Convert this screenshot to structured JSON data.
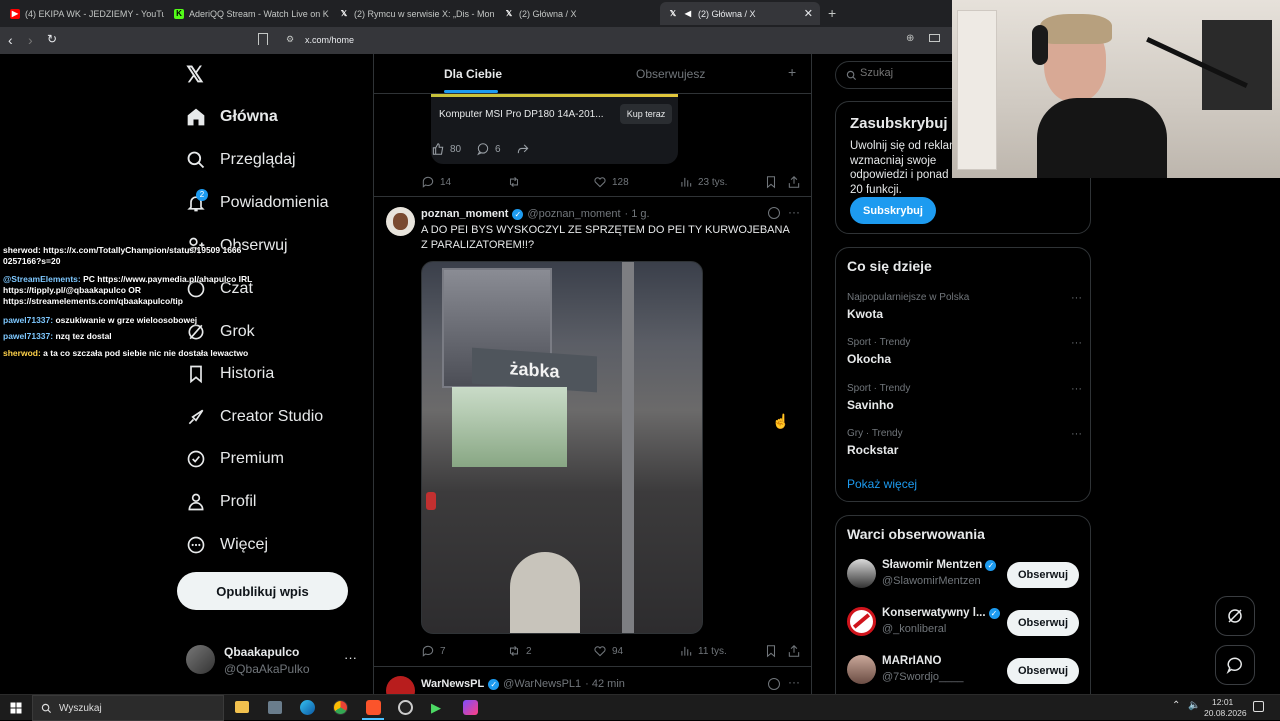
{
  "browser": {
    "tabs": [
      {
        "label": "(4) EKIPA WK - JEDZIEMY - YouTube",
        "color": "#ff0000"
      },
      {
        "label": "AderiQQ Stream - Watch Live on Kick",
        "color": "#53fc18"
      },
      {
        "label": "(2) Rymcu w serwisie X: „Dis - Monst",
        "color": "#ffffff"
      },
      {
        "label": "(2) Główna / X",
        "color": "#ffffff"
      },
      {
        "label": "(2) Główna / X",
        "color": "#ffffff"
      }
    ],
    "url": "x.com/home"
  },
  "sidebar": {
    "items": [
      {
        "label": "Główna",
        "icon": "home-icon"
      },
      {
        "label": "Przeglądaj",
        "icon": "search-icon"
      },
      {
        "label": "Powiadomienia",
        "icon": "bell-icon",
        "badge": "2"
      },
      {
        "label": "Obserwuj",
        "icon": "person-add-icon"
      },
      {
        "label": "Czat",
        "icon": "chat-icon"
      },
      {
        "label": "Grok",
        "icon": "grok-icon"
      },
      {
        "label": "Historia",
        "icon": "bookmark-icon"
      },
      {
        "label": "Creator Studio",
        "icon": "rocket-icon"
      },
      {
        "label": "Premium",
        "icon": "verified-icon"
      },
      {
        "label": "Profil",
        "icon": "profile-icon"
      },
      {
        "label": "Więcej",
        "icon": "more-icon"
      }
    ],
    "post_button": "Opublikuj wpis",
    "account": {
      "name": "Qbaakapulco",
      "handle": "@QbaAkaPulko"
    }
  },
  "feed": {
    "tabs": [
      "Dla Ciebie",
      "Obserwujesz"
    ],
    "ad": {
      "product": "Komputer MSI Pro DP180 14A-201...",
      "button": "Kup teraz",
      "likes": "80",
      "replies": "6"
    },
    "post0_stats": {
      "replies": "14",
      "likes": "128",
      "views": "23 tys."
    },
    "post1": {
      "name": "poznan_moment",
      "handle": "@poznan_moment",
      "time": "· 1 g.",
      "text": "A DO PEI BYS WYSKOCZYL ZE SPRZĘTEM DO PEI TY KURWOJEBANA Z PARALIZATOREM!!?",
      "stats": {
        "replies": "7",
        "reposts": "2",
        "likes": "94",
        "views": "11 tys."
      }
    },
    "post2": {
      "name": "WarNewsPL",
      "handle": "@WarNewsPL1",
      "time": "· 42 min"
    }
  },
  "right": {
    "search_placeholder": "Szukaj",
    "subscribe": {
      "title": "Zasubskrybuj",
      "text": "Uwolnij się od reklam, wzmacniaj swoje odpowiedzi i ponad 20 funkcji.",
      "button": "Subskrybuj"
    },
    "trends": {
      "title": "Co się dzieje",
      "items": [
        {
          "meta": "Najpopularniejsze w Polska",
          "name": "Kwota"
        },
        {
          "meta": "Sport · Trendy",
          "name": "Okocha"
        },
        {
          "meta": "Sport · Trendy",
          "name": "Savinho"
        },
        {
          "meta": "Gry · Trendy",
          "name": "Rockstar"
        }
      ],
      "show_more": "Pokaż więcej"
    },
    "who_to_follow": {
      "title": "Warci obserwowania",
      "users": [
        {
          "name": "Sławomir Mentzen",
          "handle": "@SlawomirMentzen"
        },
        {
          "name": "Konserwatywny l...",
          "handle": "@_konliberal"
        },
        {
          "name": "MARrIANO",
          "handle": "@7Swordjo____"
        }
      ],
      "follow_label": "Obserwuj"
    }
  },
  "chat": {
    "lines": [
      {
        "user": "sherwod:",
        "text": "https://x.com/TotallyChampion/status/19509 1666 0257166?s=20",
        "user_color": "#ffffff"
      },
      {
        "user": "@StreamElements:",
        "text": "PC https://www.paymedia.pl/ahapulco IRL https://tipply.pl/@qbaakapulco OR https://streamelements.com/qbaakapulco/tip",
        "user_color": "#7ec8ff"
      },
      {
        "user": "pawel71337:",
        "text": "oszukiwanie w grze wieloosobowej",
        "user_color": "#7ec8ff"
      },
      {
        "user": "pawel71337:",
        "text": "nzq tez dostal",
        "user_color": "#7ec8ff"
      },
      {
        "user": "sherwod:",
        "text": "a ta co szczała pod siebie nic nie dostała lewactwo",
        "user_color": "#ffd24a"
      }
    ]
  },
  "taskbar": {
    "search": "Wyszukaj",
    "time": "12:01",
    "date": "20.08.2026"
  },
  "colors": {
    "accent": "#1d9bf0",
    "bg": "#000000",
    "border": "#2f3336",
    "muted": "#71767b"
  }
}
